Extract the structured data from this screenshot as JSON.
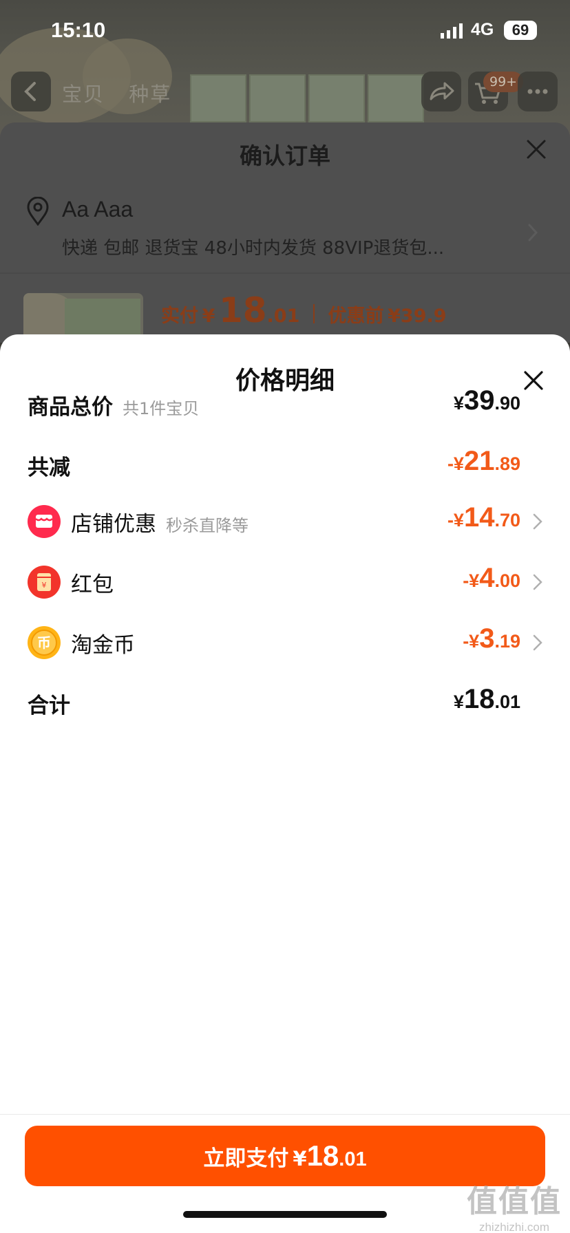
{
  "status_bar": {
    "time": "15:10",
    "network": "4G",
    "battery": "69"
  },
  "product_page": {
    "tabs": [
      "宝贝",
      "种草"
    ],
    "cart_badge": "99+"
  },
  "order_sheet": {
    "title": "确认订单",
    "address_name": "Aa Aaa",
    "services": "快递 包邮 退货宝 48小时内发货 88VIP退货包...",
    "paid_label": "实付",
    "paid_yen": "¥",
    "paid_int": "18",
    "paid_dec": ".01",
    "before_label": "优惠前",
    "before_price": "¥39.9"
  },
  "price_detail": {
    "title": "价格明细",
    "rows": [
      {
        "label": "商品总价",
        "sub": "共1件宝贝",
        "yen": "¥",
        "int": "39",
        "dec": ".90"
      },
      {
        "label": "共减",
        "yen": "-¥",
        "int": "21",
        "dec": ".89"
      },
      {
        "label": "店铺优惠",
        "sub": "秒杀直降等",
        "icon": "store-discount-icon",
        "yen": "-¥",
        "int": "14",
        "dec": ".70"
      },
      {
        "label": "红包",
        "icon": "red-packet-icon",
        "yen": "-¥",
        "int": "4",
        "dec": ".00"
      },
      {
        "label": "淘金币",
        "icon": "taojinbi-coin-icon",
        "yen": "-¥",
        "int": "3",
        "dec": ".19"
      },
      {
        "label": "合计",
        "yen": "¥",
        "int": "18",
        "dec": ".01"
      }
    ]
  },
  "pay_button": {
    "label": "立即支付",
    "yen": "¥",
    "int": "18",
    "dec": ".01"
  },
  "watermark": {
    "text": "值值值",
    "domain": "zhizhizhi.com"
  },
  "colors": {
    "accent": "#ff5000",
    "discount": "#f25a19"
  }
}
